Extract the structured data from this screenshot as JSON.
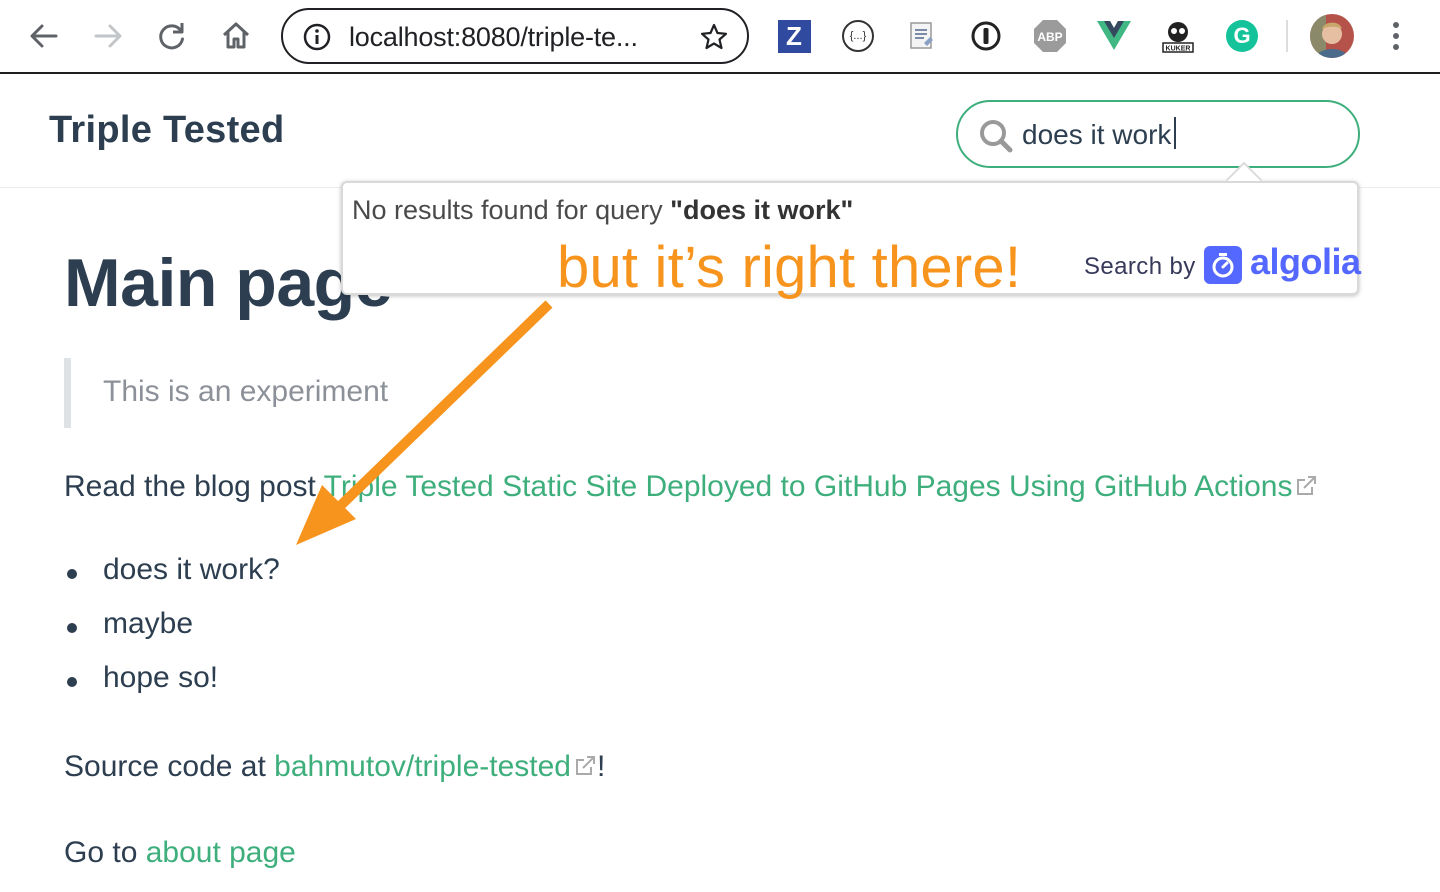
{
  "browser": {
    "url": "localhost:8080/triple-te...",
    "extensions": [
      "zotero-icon",
      "json-formatter-icon",
      "notes-icon",
      "onepassword-icon",
      "adblock-plus-icon",
      "vue-devtools-icon",
      "kuker-icon",
      "grammarly-icon",
      "profile-avatar"
    ],
    "extension_labels": {
      "zotero": "Z",
      "json": "{...}",
      "abp": "ABP",
      "kuker": "KUKER",
      "grammarly": "G"
    }
  },
  "navbar": {
    "site_name": "Triple Tested",
    "search_value": "does it work"
  },
  "search_dropdown": {
    "empty_prefix": "No results found for query ",
    "empty_query": "\"does it work\"",
    "search_by_label": "Search by",
    "algolia_label": "algolia"
  },
  "annotation": {
    "text": "but it’s right there!",
    "color": "#f7941d"
  },
  "content": {
    "title": "Main page",
    "blockquote": "This is an experiment",
    "blog_intro": "Read the blog post ",
    "blog_link": "Triple Tested Static Site Deployed to GitHub Pages Using GitHub Actions",
    "list_items": [
      "does it work?",
      "maybe",
      "hope so!"
    ],
    "source_intro": "Source code at ",
    "source_link": "bahmutov/triple-tested",
    "source_suffix": "!",
    "about_intro": "Go to ",
    "about_link": "about page"
  },
  "colors": {
    "accent": "#3eaf7c",
    "text": "#2c3e50",
    "algolia": "#5468ff"
  }
}
